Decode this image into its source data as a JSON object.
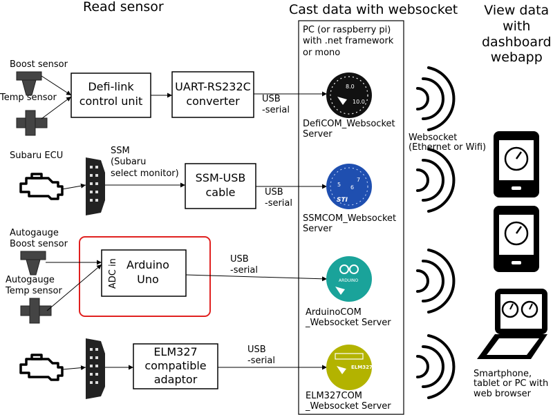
{
  "headers": {
    "read_sensor": "Read sensor",
    "cast_data": "Cast data with websocket",
    "view_data": "View data\nwith\ndashboard\nwebapp"
  },
  "sensors": {
    "boost": "Boost sensor",
    "temp": "Temp sensor",
    "subaru_ecu": "Subaru ECU",
    "autogauge_boost": "Autogauge\nBoost sensor",
    "autogauge_temp": "Autogauge\nTemp sensor"
  },
  "boxes": {
    "defi_link": "Defi-link\ncontrol unit",
    "uart": "UART-RS232C\nconverter",
    "ssm_usb": "SSM-USB\ncable",
    "arduino": "Arduino\nUno",
    "adc_in": "ADC in",
    "elm327": "ELM327\ncompatible\nadaptor"
  },
  "connections": {
    "ssm": "SSM\n(Subaru\nselect monitor)",
    "usb_serial": "USB\n-serial"
  },
  "server_panel": {
    "title": "PC (or raspberry pi)\nwith .net framework\nor mono"
  },
  "servers": [
    {
      "name": "DefiCOM_Websocket\nServer",
      "color": "#111111",
      "dial": [
        "8.0",
        "10.0"
      ]
    },
    {
      "name": "SSMCOM_Websocket\nServer",
      "color": "#1f4fb0",
      "dial": [
        "5",
        "6",
        "7",
        "STI"
      ]
    },
    {
      "name": "ArduinoCOM\n_Websocket Server",
      "color": "#1aa39a",
      "dial": [
        "ARDUINO"
      ]
    },
    {
      "name": "ELM327COM\n_Websocket Server",
      "color": "#b3b300",
      "dial": [
        "ELM327"
      ]
    }
  ],
  "websocket_label": "Websocket\n(Ethernet or Wifi)",
  "devices_label": "Smartphone,\ntablet or PC with\nweb browser",
  "colors": {
    "highlight": "#e0201f",
    "line": "#000000"
  }
}
